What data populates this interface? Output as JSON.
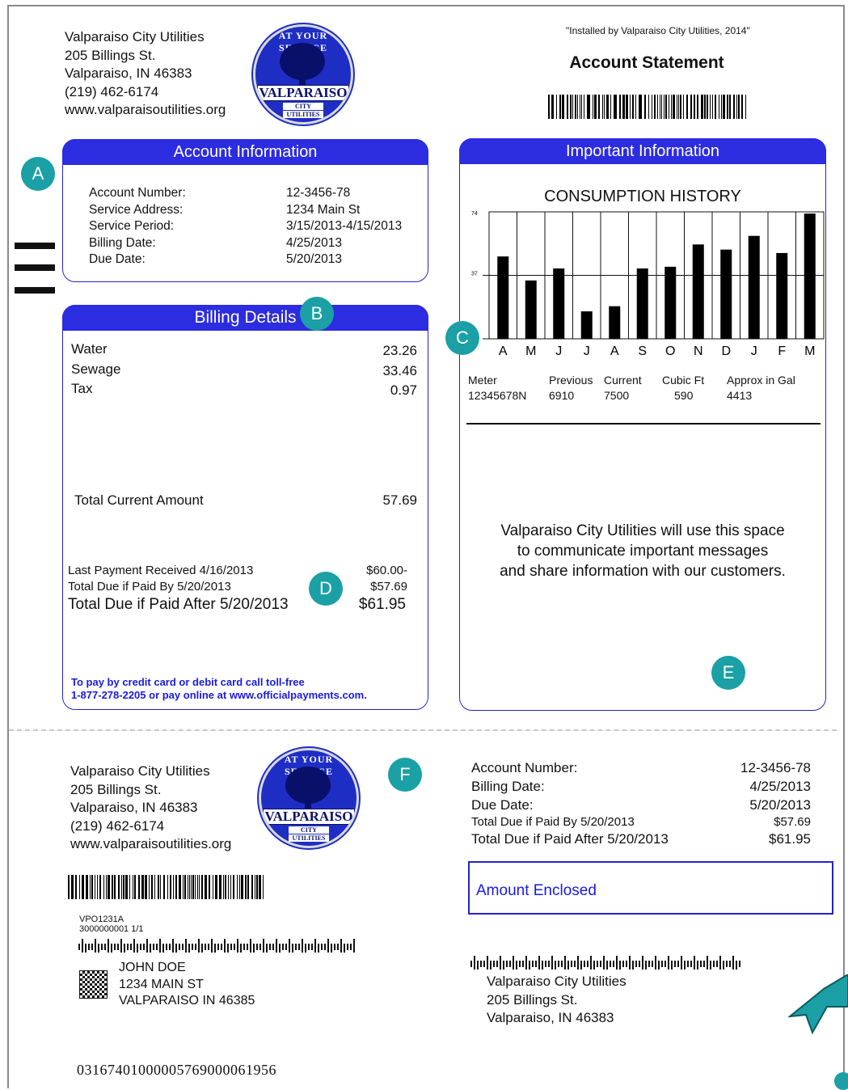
{
  "utility": {
    "name": "Valparaiso City Utilities",
    "street": "205 Billings St.",
    "city": "Valparaiso, IN 46383",
    "phone": "(219) 462-6174",
    "web": "www.valparaisoutilities.org"
  },
  "seal": {
    "arc_text": "AT YOUR SERVICE",
    "big": "VALPARAISO",
    "line1": "CITY",
    "line2": "UTILITIES"
  },
  "installed_note": "\"Installed by Valparaiso City Utilities, 2014\"",
  "statement_title": "Account Statement",
  "markers": [
    "A",
    "B",
    "C",
    "D",
    "E",
    "F"
  ],
  "account_info": {
    "header": "Account Information",
    "rows": [
      {
        "label": "Account Number:",
        "value": "12-3456-78"
      },
      {
        "label": "Service Address:",
        "value": "1234 Main St"
      },
      {
        "label": "Service Period:",
        "value": "3/15/2013-4/15/2013"
      },
      {
        "label": "Billing Date:",
        "value": "4/25/2013"
      },
      {
        "label": "Due Date:",
        "value": "5/20/2013"
      }
    ]
  },
  "billing": {
    "header": "Billing Details",
    "charges": [
      {
        "label": "Water",
        "value": "23.26"
      },
      {
        "label": "Sewage",
        "value": "33.46"
      },
      {
        "label": "Tax",
        "value": "0.97"
      }
    ],
    "total_label": "Total Current Amount",
    "total_value": "57.69",
    "last_payment": {
      "label": "Last Payment Received 4/16/2013",
      "value": "$60.00-"
    },
    "due_by": {
      "label": "Total Due if Paid By 5/20/2013",
      "value": "$57.69"
    },
    "due_after": {
      "label": "Total Due if Paid After 5/20/2013",
      "value": "$61.95"
    },
    "pay_note_1": "To pay by credit card or debit card call toll-free",
    "pay_note_2": "1-877-278-2205 or pay online at www.officialpayments.com."
  },
  "important": {
    "header": "Important Information",
    "message_1": "Valparaiso City Utilities will use this space",
    "message_2": "to communicate important messages",
    "message_3": "and share information with our customers.",
    "meter_table": {
      "headers": [
        "Meter",
        "Previous",
        "Current",
        "Cubic Ft",
        "Approx in Gal"
      ],
      "values": [
        "12345678N",
        "6910",
        "7500",
        "590",
        "4413"
      ]
    }
  },
  "chart_data": {
    "type": "bar",
    "title": "CONSUMPTION HISTORY",
    "categories": [
      "A",
      "M",
      "J",
      "J",
      "A",
      "S",
      "O",
      "N",
      "D",
      "J",
      "F",
      "M"
    ],
    "values": [
      48,
      34,
      41,
      16,
      19,
      41,
      42,
      55,
      52,
      60,
      50,
      73
    ],
    "yticks": [
      "74",
      "37"
    ],
    "ylim": [
      0,
      74
    ],
    "grid": true
  },
  "stub": {
    "account_number_label": "Account Number:",
    "account_number": "12-3456-78",
    "billing_date_label": "Billing Date:",
    "billing_date": "4/25/2013",
    "due_date_label": "Due Date:",
    "due_date": "5/20/2013",
    "due_by_label": "Total Due if Paid By 5/20/2013",
    "due_by": "$57.69",
    "due_after_label": "Total Due if Paid After 5/20/2013",
    "due_after": "$61.95",
    "amount_enclosed_label": "Amount Enclosed",
    "mail_code_1": "VPO1231A",
    "mail_code_2": "3000000001 1/1",
    "customer": {
      "name": "JOHN DOE",
      "street": "1234 MAIN ST",
      "city": "VALPARAISO IN 46385"
    },
    "scan_line": "03167401000005769000061956"
  }
}
